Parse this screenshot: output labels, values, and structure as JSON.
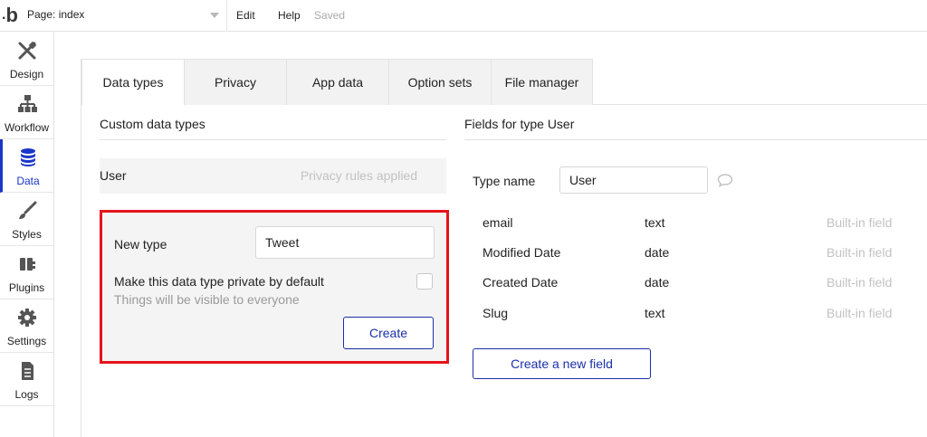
{
  "topbar": {
    "logo_text": "b",
    "page_label": "Page: index",
    "menu_edit": "Edit",
    "menu_help": "Help",
    "save_status": "Saved"
  },
  "sidebar": {
    "items": [
      {
        "label": "Design",
        "icon": "design-icon"
      },
      {
        "label": "Workflow",
        "icon": "workflow-icon"
      },
      {
        "label": "Data",
        "icon": "database-icon",
        "active": true
      },
      {
        "label": "Styles",
        "icon": "brush-icon"
      },
      {
        "label": "Plugins",
        "icon": "plug-icon"
      },
      {
        "label": "Settings",
        "icon": "gear-icon"
      },
      {
        "label": "Logs",
        "icon": "document-icon"
      }
    ]
  },
  "tabs": [
    {
      "label": "Data types",
      "active": true
    },
    {
      "label": "Privacy"
    },
    {
      "label": "App data"
    },
    {
      "label": "Option sets"
    },
    {
      "label": "File manager"
    }
  ],
  "custom_types": {
    "title": "Custom data types",
    "types": [
      {
        "name": "User",
        "status": "Privacy rules applied"
      }
    ]
  },
  "new_type": {
    "label": "New type",
    "value": "Tweet",
    "private_label": "Make this data type private by default",
    "private_sub": "Things will be visible to everyone",
    "private_checked": false,
    "create_label": "Create"
  },
  "fields_panel": {
    "title": "Fields for type User",
    "type_name_label": "Type name",
    "type_name_value": "User",
    "fields": [
      {
        "name": "email",
        "type": "text",
        "note": "Built-in field"
      },
      {
        "name": "Modified Date",
        "type": "date",
        "note": "Built-in field"
      },
      {
        "name": "Created Date",
        "type": "date",
        "note": "Built-in field"
      },
      {
        "name": "Slug",
        "type": "text",
        "note": "Built-in field"
      }
    ],
    "new_field_label": "Create a new field"
  },
  "colors": {
    "accent": "#1a36c8",
    "highlight_border": "#e5141c"
  }
}
